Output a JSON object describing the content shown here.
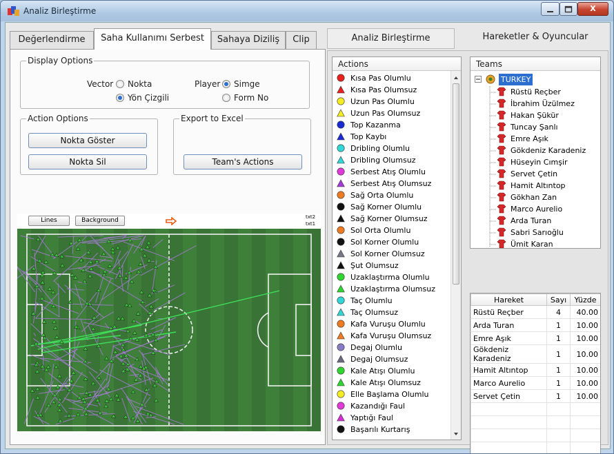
{
  "window": {
    "title": "Analiz Birleştirme",
    "close_label": "X"
  },
  "left_tabs": [
    "Değerlendirme",
    "Saha Kullanımı Serbest",
    "Sahaya Diziliş",
    "Clip"
  ],
  "display_options": {
    "label": "Display Options",
    "vector_label": "Vector",
    "vector_options": [
      "Nokta",
      "Yön Çizgili"
    ],
    "vector_selected": "Yön Çizgili",
    "player_label": "Player",
    "player_options": [
      "Simge",
      "Form No"
    ],
    "player_selected": "Simge"
  },
  "action_options": {
    "label": "Action Options",
    "show_points": "Nokta Göster",
    "delete_points": "Nokta Sil"
  },
  "export_excel": {
    "label": "Export to Excel",
    "team_actions": "Team's Actions"
  },
  "pitch": {
    "lines_button": "Lines",
    "background_button": "Background",
    "legend_top": "txt2",
    "legend_bottom": "txt1"
  },
  "right_tabs": [
    "Analiz Birleştirme",
    "Hareketler & Oyuncular"
  ],
  "actions": {
    "header": "Actions",
    "items": [
      {
        "label": "Kısa Pas Olumlu",
        "shape": "circle",
        "color": "#e8211c"
      },
      {
        "label": "Kısa Pas Olumsuz",
        "shape": "triangle",
        "color": "#e8211c"
      },
      {
        "label": "Uzun Pas Olumlu",
        "shape": "circle",
        "color": "#f5ec21"
      },
      {
        "label": "Uzun Pas Olumsuz",
        "shape": "triangle",
        "color": "#f5ec21"
      },
      {
        "label": "Top Kazanma",
        "shape": "circle",
        "color": "#1a2bd4"
      },
      {
        "label": "Top Kaybı",
        "shape": "triangle",
        "color": "#1a2bd4"
      },
      {
        "label": "Dribling Olumlu",
        "shape": "circle",
        "color": "#31d6d6"
      },
      {
        "label": "Dribling Olumsuz",
        "shape": "triangle",
        "color": "#31d6d6"
      },
      {
        "label": "Serbest Atış Olumlu",
        "shape": "circle",
        "color": "#e23ad8"
      },
      {
        "label": "Serbest Atış Olumsuz",
        "shape": "triangle",
        "color": "#a53ad8"
      },
      {
        "label": "Sağ Orta Olumlu",
        "shape": "circle",
        "color": "#ee7a22"
      },
      {
        "label": "Sağ Korner Olumlu",
        "shape": "circle",
        "color": "#111111"
      },
      {
        "label": "Sağ Korner Olumsuz",
        "shape": "triangle",
        "color": "#111111"
      },
      {
        "label": "Sol Orta Olumlu",
        "shape": "circle",
        "color": "#ee7a22"
      },
      {
        "label": "Sol Korner Olumlu",
        "shape": "circle",
        "color": "#111111"
      },
      {
        "label": "Sol Korner Olumsuz",
        "shape": "triangle",
        "color": "#777788"
      },
      {
        "label": "Şut Olumsuz",
        "shape": "triangle",
        "color": "#111111"
      },
      {
        "label": "Uzaklaştırma Olumlu",
        "shape": "circle",
        "color": "#2fd62f"
      },
      {
        "label": "Uzaklaştırma Olumsuz",
        "shape": "triangle",
        "color": "#2fd62f"
      },
      {
        "label": "Taç Olumlu",
        "shape": "circle",
        "color": "#31d6d6"
      },
      {
        "label": "Taç Olumsuz",
        "shape": "triangle",
        "color": "#31d6d6"
      },
      {
        "label": "Kafa Vuruşu Olumlu",
        "shape": "circle",
        "color": "#ee7a22"
      },
      {
        "label": "Kafa Vuruşu Olumsuz",
        "shape": "triangle",
        "color": "#ee7a22"
      },
      {
        "label": "Degaj Olumlu",
        "shape": "circle",
        "color": "#8a79c4"
      },
      {
        "label": "Degaj Olumsuz",
        "shape": "triangle",
        "color": "#6a6a80"
      },
      {
        "label": "Kale Atışı Olumlu",
        "shape": "circle",
        "color": "#2fd62f"
      },
      {
        "label": "Kale Atışı Olumsuz",
        "shape": "triangle",
        "color": "#2fd62f"
      },
      {
        "label": "Elle Başlama Olumlu",
        "shape": "circle",
        "color": "#f5ec21"
      },
      {
        "label": "Kazandığı Faul",
        "shape": "circle",
        "color": "#e23ad8"
      },
      {
        "label": "Yaptığı Faul",
        "shape": "triangle",
        "color": "#d62fd6"
      },
      {
        "label": "Başarılı Kurtarış",
        "shape": "circle",
        "color": "#111111"
      }
    ]
  },
  "teams": {
    "header": "Teams",
    "team_name": "TURKEY",
    "players": [
      "Rüstü Reçber",
      "İbrahim Üzülmez",
      "Hakan Şükür",
      "Tuncay Şanlı",
      "Emre Aşık",
      "Gökdeniz Karadeniz",
      "Hüseyin Cımşir",
      "Servet Çetin",
      "Hamit Altıntop",
      "Gökhan Zan",
      "Marco Aurelio",
      "Arda Turan",
      "Sabri Sarıoğlu",
      "Ümit Karan"
    ]
  },
  "stats_table": {
    "headers": [
      "Hareket",
      "Sayı",
      "Yüzde"
    ],
    "rows": [
      [
        "Rüstü Reçber",
        "4",
        "40.00"
      ],
      [
        "Arda Turan",
        "1",
        "10.00"
      ],
      [
        "Emre Aşık",
        "1",
        "10.00"
      ],
      [
        "Gökdeniz Karadeniz",
        "1",
        "10.00"
      ],
      [
        "Hamit Altıntop",
        "1",
        "10.00"
      ],
      [
        "Marco Aurelio",
        "1",
        "10.00"
      ],
      [
        "Servet Çetin",
        "1",
        "10.00"
      ]
    ]
  },
  "colors": {
    "accent": "#2d6fd0",
    "pitch": "#3d7a3a",
    "vector_lines": "#a77ad6",
    "highlight_lines": "#3ee05a",
    "player_icon": "#d62828"
  }
}
